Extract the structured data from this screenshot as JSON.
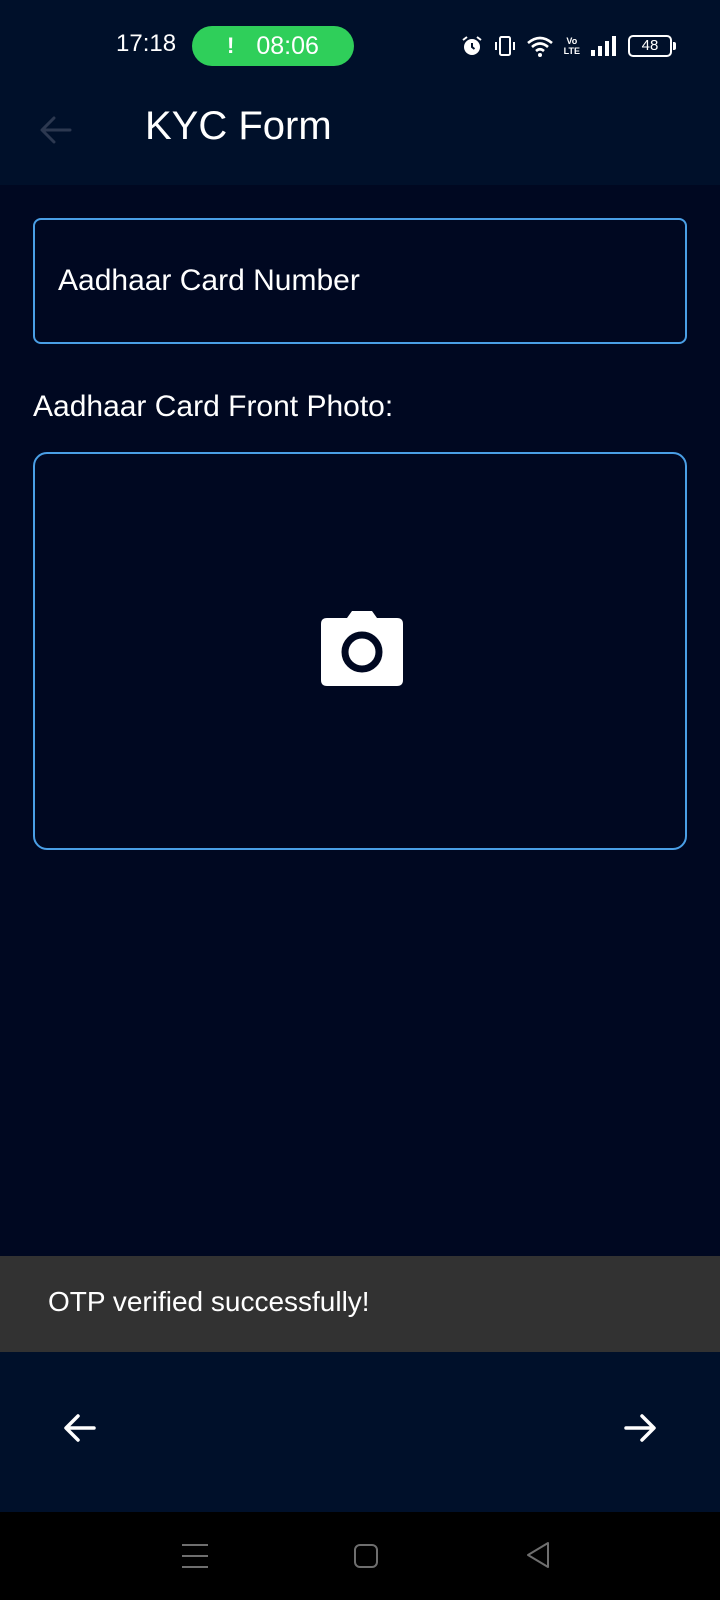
{
  "status_bar": {
    "time": "17:18",
    "call_timer": "08:06",
    "call_indicator": "!",
    "volte_line1": "Vo",
    "volte_line2": "LTE",
    "battery": "48",
    "icons": [
      "alarm-icon",
      "vibrate-icon",
      "wifi-icon",
      "volte-icon",
      "signal-icon",
      "battery-icon"
    ]
  },
  "app_bar": {
    "title": "KYC Form",
    "back_icon": "arrow-left-icon"
  },
  "form": {
    "aadhaar_number": {
      "placeholder": "Aadhaar Card Number",
      "value": ""
    },
    "front_photo_label": "Aadhaar Card Front Photo:",
    "photo_icon": "camera-icon"
  },
  "snackbar": {
    "message": "OTP verified successfully!"
  },
  "bottom_nav": {
    "prev_icon": "arrow-left-icon",
    "next_icon": "arrow-right-icon"
  },
  "system_nav": {
    "icons": [
      "menu-icon",
      "home-icon",
      "back-icon"
    ]
  },
  "colors": {
    "background": "#000821",
    "header": "#00102a",
    "accent_border": "#4a9fe6",
    "call_pill": "#2fcf5a",
    "snackbar": "#323232"
  }
}
